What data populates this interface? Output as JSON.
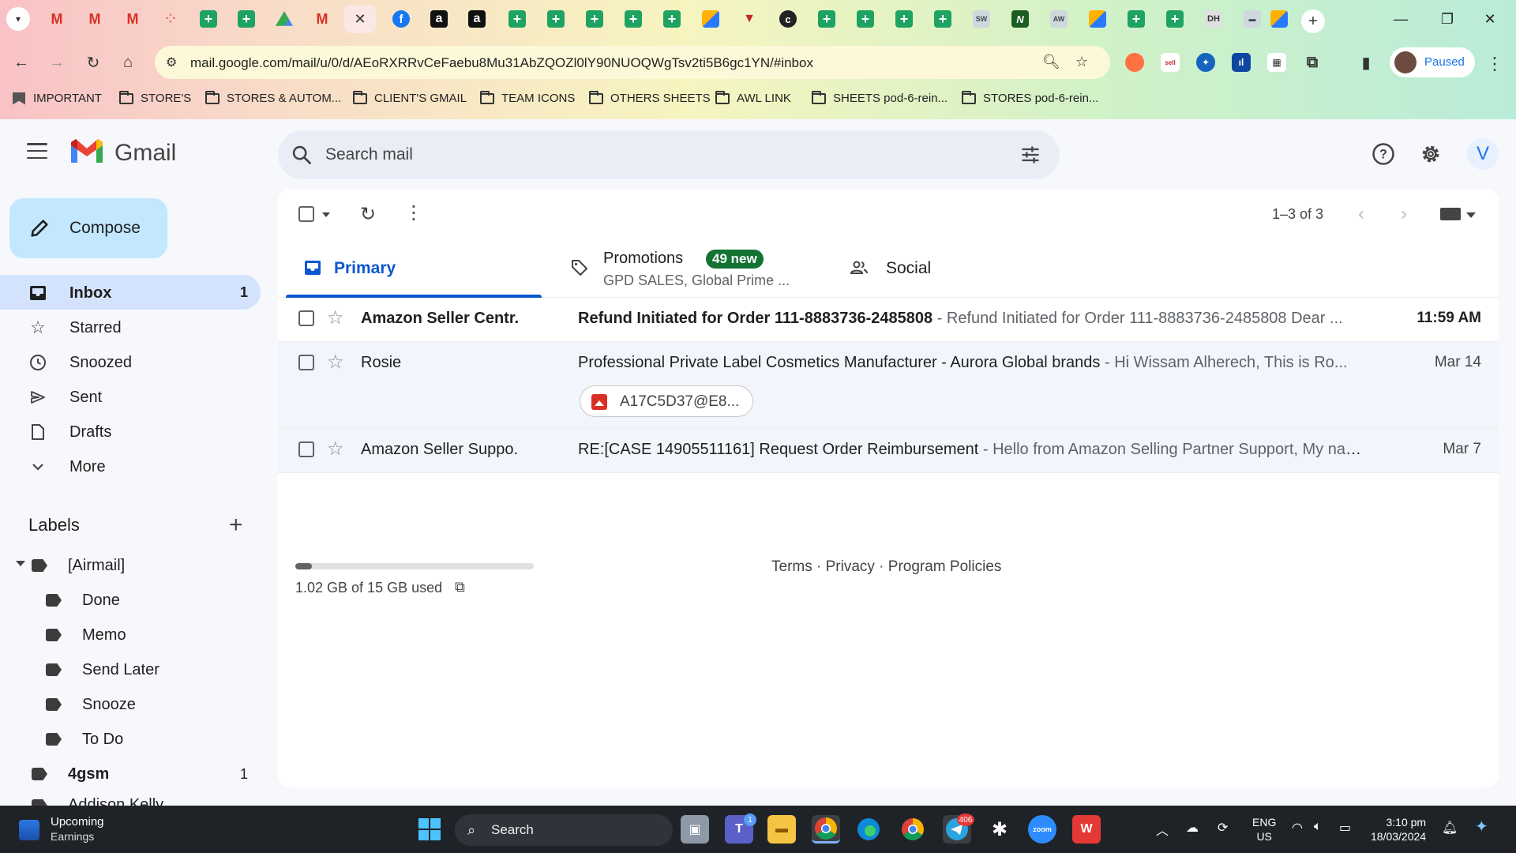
{
  "browser": {
    "address_url": "mail.google.com/mail/u/0/d/AEoRXRRvCeFaebu8Mu31AbZQOZl0lY90NUOQWgTsv2ti5B6gc1YN/#inbox",
    "profile_status": "Paused",
    "bookmarks": [
      "IMPORTANT",
      "STORE'S",
      "STORES & AUTOM...",
      "CLIENT'S GMAIL",
      "TEAM ICONS",
      "OTHERS SHEETS",
      "AWL LINK",
      "SHEETS pod-6-rein...",
      "STORES pod-6-rein..."
    ]
  },
  "gmail": {
    "product_name": "Gmail",
    "search_placeholder": "Search mail",
    "avatar_letter": "V",
    "compose_label": "Compose",
    "nav": [
      {
        "label": "Inbox",
        "count": "1",
        "icon": "inbox-icon"
      },
      {
        "label": "Starred",
        "count": "",
        "icon": "star-icon"
      },
      {
        "label": "Snoozed",
        "count": "",
        "icon": "clock-icon"
      },
      {
        "label": "Sent",
        "count": "",
        "icon": "send-icon"
      },
      {
        "label": "Drafts",
        "count": "",
        "icon": "draft-icon"
      },
      {
        "label": "More",
        "count": "",
        "icon": "chevron-down-icon"
      }
    ],
    "labels_title": "Labels",
    "labels": [
      {
        "name": "[Airmail]",
        "count": ""
      },
      {
        "name": "Done",
        "count": ""
      },
      {
        "name": "Memo",
        "count": ""
      },
      {
        "name": "Send Later",
        "count": ""
      },
      {
        "name": "Snooze",
        "count": ""
      },
      {
        "name": "To Do",
        "count": ""
      },
      {
        "name": "4gsm",
        "count": "1"
      },
      {
        "name": "Addison Kelly",
        "count": ""
      }
    ],
    "pagination": "1–3 of 3",
    "tabs": {
      "primary": "Primary",
      "promotions": "Promotions",
      "promotions_badge": "49 new",
      "promotions_sub": "GPD SALES, Global Prime ...",
      "social": "Social"
    },
    "emails": [
      {
        "sender": "Amazon Seller Centr.",
        "subject": "Refund Initiated for Order 111-8883736-2485808",
        "snippet": " - Refund Initiated for Order 111-8883736-2485808 Dear ...",
        "date": "11:59 AM",
        "unread": true
      },
      {
        "sender": "Rosie",
        "subject": "Professional Private Label Cosmetics Manufacturer - Aurora Global brands",
        "snippet": " - Hi Wissam Alherech, This is Ro...",
        "date": "Mar 14",
        "unread": false,
        "attachment": "A17C5D37@E8..."
      },
      {
        "sender": "Amazon Seller Suppo.",
        "subject": "RE:[CASE 14905511161] Request Order Reimbursement",
        "snippet": " - Hello from Amazon Selling Partner Support, My nam...",
        "date": "Mar 7",
        "unread": false
      }
    ],
    "storage_text": "1.02 GB of 15 GB used",
    "storage_fraction": 0.068,
    "footer": "Terms · Privacy · Program Policies"
  },
  "taskbar": {
    "widget_title": "Upcoming",
    "widget_sub": "Earnings",
    "search_label": "Search",
    "teams_badge": "1",
    "telegram_badge": "406",
    "lang_line1": "ENG",
    "lang_line2": "US",
    "time": "3:10 pm",
    "date": "18/03/2024"
  }
}
